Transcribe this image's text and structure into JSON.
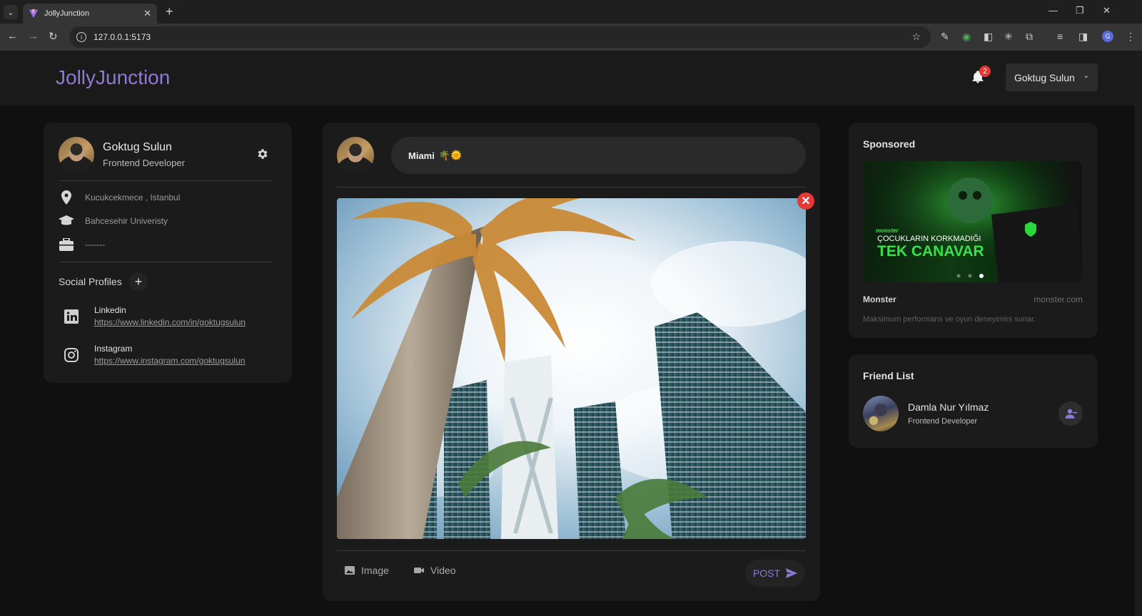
{
  "browser": {
    "tab_title": "JollyJunction",
    "url": "127.0.0.1:5173",
    "profile_initial": "G"
  },
  "app": {
    "logo": "JollyJunction",
    "notification_count": "2",
    "user_menu_label": "Goktug Sulun"
  },
  "profile": {
    "name": "Goktug Sulun",
    "role": "Frontend Developer",
    "location": "Kucukcekmece , Istanbul",
    "school": "Bahcesehir Univeristy",
    "job": "-------",
    "social_title": "Social Profiles",
    "socials": [
      {
        "name": "Linkedin",
        "url": "https://www.linkedin.com/in/goktugsulun"
      },
      {
        "name": "Instagram",
        "url": "https://www.instagram.com/goktugsulun"
      }
    ]
  },
  "composer": {
    "text": "Miami",
    "emoji": "🌴🌞",
    "image_label": "Image",
    "video_label": "Video",
    "post_label": "POST"
  },
  "sponsored": {
    "title": "Sponsored",
    "ad_line1": "ÇOCUKLARIN KORKMADIĞI",
    "ad_line2": "TEK CANAVAR",
    "ad_logo": "monster",
    "brand": "Monster",
    "site": "monster.com",
    "description": "Maksimum performans ve oyun deneyimini sunar."
  },
  "friend_list": {
    "title": "Friend List",
    "friends": [
      {
        "name": "Damla Nur Yılmaz",
        "role": "Frontend Developer"
      }
    ]
  },
  "colors": {
    "accent": "#8e7ad6",
    "danger": "#e53935",
    "card": "#1b1b1b"
  }
}
